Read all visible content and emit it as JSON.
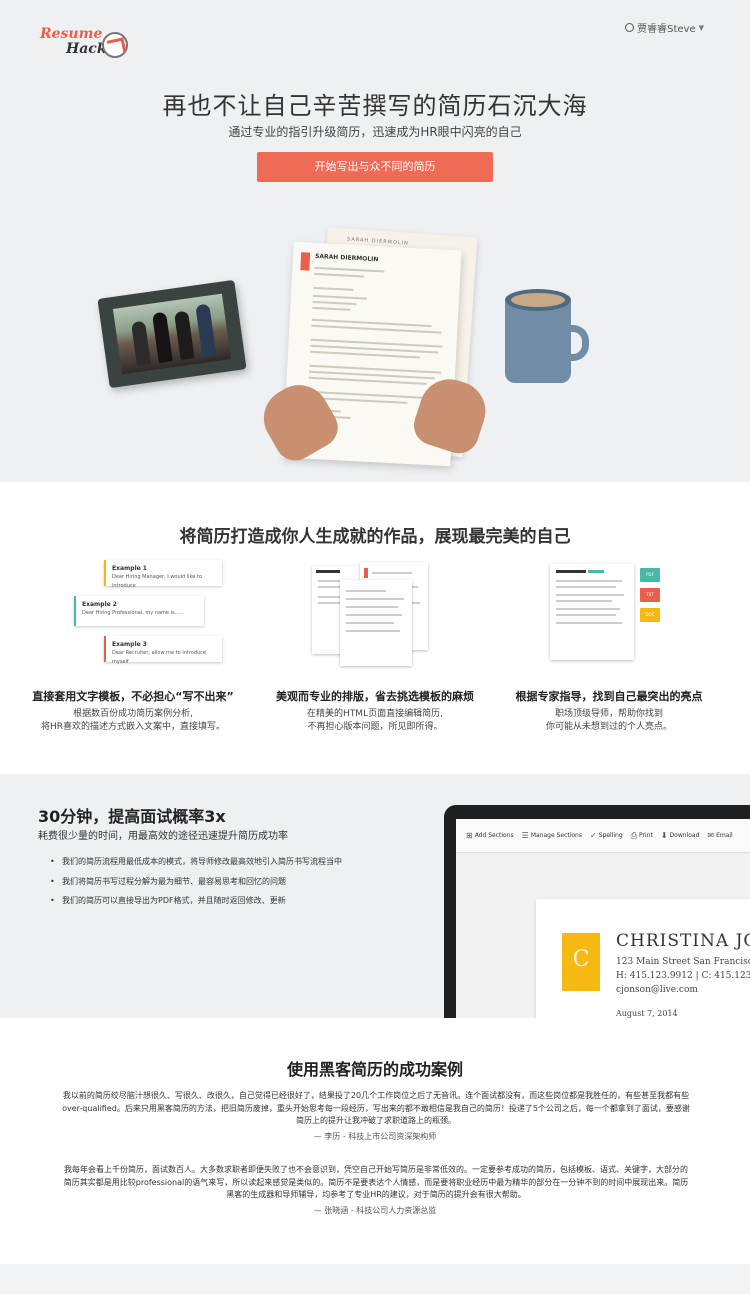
{
  "header": {
    "logo_line1": "Resume",
    "logo_line2": "Hack",
    "user_name": "贾睿睿Steve"
  },
  "hero": {
    "title": "再也不让自己辛苦撰写的简历石沉大海",
    "subtitle": "通过专业的指引升级简历，迅速成为HR眼中闪亮的自己",
    "cta_label": "开始写出与众不同的简历",
    "resume_back_title": "SARAH DIERMOLIN",
    "resume_front_title": "SARAH DIERMOLIN"
  },
  "features": {
    "title": "将简历打造成你人生成就的作品，展现最完美的自己",
    "items": [
      {
        "title": "直接套用文字模板，不必担心“写不出来”",
        "desc_line1": "根据数百份成功简历案例分析,",
        "desc_line2": "将HR喜欢的描述方式嵌入文案中，直接填写。"
      },
      {
        "title": "美观而专业的排版，省去挑选模板的麻烦",
        "desc_line1": "在精美的HTML页面直接编辑简历,",
        "desc_line2": "不再担心版本问题，所见即所得。"
      },
      {
        "title": "根据专家指导，找到自己最突出的亮点",
        "desc_line1": "职场顶级导师，帮助你找到",
        "desc_line2": "你可能从未想到过的个人亮点。"
      }
    ],
    "example_cards": [
      {
        "title": "Example 1",
        "text": "Dear Hiring Manager, I would like to introduce"
      },
      {
        "title": "Example 2",
        "text": "Dear Hiring Professional, my name is......"
      },
      {
        "title": "Example 3",
        "text": "Dear Recruiter, allow me to introduce myself"
      }
    ],
    "format_tags": [
      "PDF",
      "TXT",
      "DOC"
    ]
  },
  "speed": {
    "title": "30分钟，提高面试概率3x",
    "subtitle": "耗费很少量的时间，用最高效的途径迅速提升简历成功率",
    "bullets": [
      "我们的简历流程用最低成本的模式，将导师修改最高效地引入简历书写流程当中",
      "我们将简历书写过程分解为最为细节、最容易思考和回忆的问题",
      "我们的简历可以直接导出为PDF格式，并且随时返回修改、更新"
    ],
    "toolbar": [
      "Add Sections",
      "Manage Sections",
      "Spelling",
      "Print",
      "Download",
      "Email"
    ],
    "resume": {
      "initial": "C",
      "name": "CHRISTINA JO",
      "address": "123 Main Street San Francisco,",
      "phone": "H: 415.123.9912  |  C: 415.123.1",
      "email": "cjonson@live.com",
      "date": "August 7, 2014"
    }
  },
  "cases": {
    "title": "使用黑客简历的成功案例",
    "quotes": [
      {
        "text_line1": "我以前的简历绞尽脑汁想很久、写很久、改很久，自己觉得已经很好了，结果投了20几个工作岗位之后了无音讯。连个面试都没有，而这些岗位都是我胜任的，有些甚至我都有些",
        "text_line2": "over-qualified。后来只用黑客简历的方法，把旧简历废掉，重头开始思考每一段经历，写出来的都不敢相信是我自己的简历！投递了5个公司之后，每一个都拿到了面试，要感谢",
        "text_line3": "简历上的提升让我冲破了求职道路上的瓶颈。",
        "author": "— 李历  - 科技上市公司资深架构师"
      },
      {
        "text_line1": "我每年会看上千份简历，面试数百人。大多数求职者即便失败了也不会意识到，凭空自己开始写简历是非常低效的。一定要参考成功的简历，包括模板、语式、关键字，大部分的",
        "text_line2": "简历其实都是用比较professional的语气来写，所以读起来感觉是类似的。简历不是要表达个人情感，而是要将职业经历中最为精华的部分在一分钟不到的时间中展现出来。简历",
        "text_line3": "黑客的生成器和导师辅导，均参考了专业HR的建议，对于简历的提升会有很大帮助。",
        "author": "— 张晓涵  - 科技公司人力资源总监"
      }
    ]
  }
}
